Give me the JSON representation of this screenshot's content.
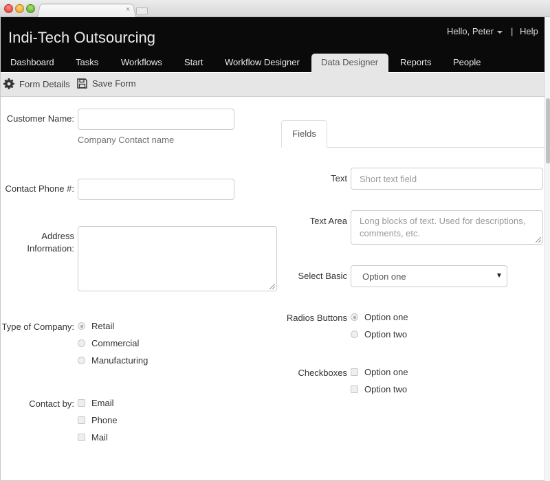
{
  "browser": {
    "tab_title": "",
    "close_glyph": "×",
    "new_tab_glyph": "+"
  },
  "header": {
    "brand": "Indi-Tech Outsourcing",
    "user_greeting": "Hello, Peter",
    "separator": "|",
    "help": "Help"
  },
  "nav": {
    "items": [
      {
        "label": "Dashboard"
      },
      {
        "label": "Tasks"
      },
      {
        "label": "Workflows"
      },
      {
        "label": "Start"
      },
      {
        "label": "Workflow Designer"
      },
      {
        "label": "Data Designer",
        "active": true
      },
      {
        "label": "Reports"
      },
      {
        "label": "People"
      }
    ]
  },
  "toolbar": {
    "form_details": "Form Details",
    "save_form": "Save Form"
  },
  "form": {
    "customer_name": {
      "label": "Customer Name:",
      "value": "",
      "help": "Company Contact name"
    },
    "contact_phone": {
      "label": "Contact Phone #:",
      "value": ""
    },
    "address": {
      "label_line1": "Address",
      "label_line2": "Information:",
      "value": ""
    },
    "company_type": {
      "label": "Type of Company:",
      "options": [
        {
          "label": "Retail",
          "checked": true
        },
        {
          "label": "Commercial",
          "checked": false
        },
        {
          "label": "Manufacturing",
          "checked": false
        }
      ]
    },
    "contact_by": {
      "label": "Contact by:",
      "options": [
        {
          "label": "Email",
          "checked": false
        },
        {
          "label": "Phone",
          "checked": false
        },
        {
          "label": "Mail",
          "checked": false
        }
      ]
    }
  },
  "palette": {
    "tab": "Fields",
    "text": {
      "label": "Text",
      "placeholder": "Short text field"
    },
    "textarea": {
      "label": "Text Area",
      "placeholder": "Long blocks of text.  Used for descriptions, comments, etc."
    },
    "select": {
      "label": "Select Basic",
      "value": "Option one"
    },
    "radios": {
      "label": "Radios Buttons",
      "options": [
        {
          "label": "Option one",
          "checked": true
        },
        {
          "label": "Option two",
          "checked": false
        }
      ]
    },
    "checkboxes": {
      "label": "Checkboxes",
      "options": [
        {
          "label": "Option one",
          "checked": false
        },
        {
          "label": "Option two",
          "checked": false
        }
      ]
    }
  }
}
